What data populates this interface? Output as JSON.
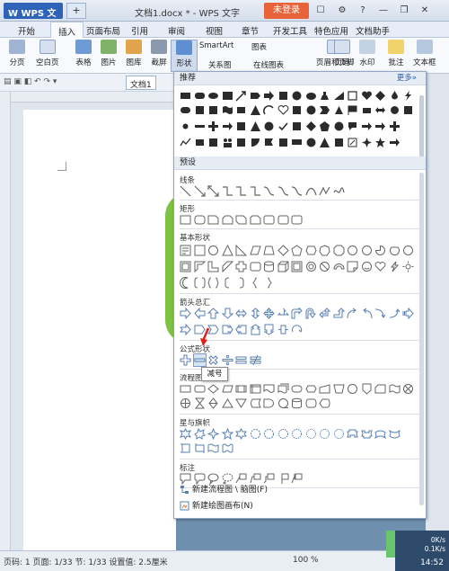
{
  "app": {
    "name": "W WPS 文字",
    "new_tab_symbol": "+",
    "window_title": "文档1.docx * - WPS 文字",
    "login_label": "未登录",
    "window_controls": [
      "minimize-icon",
      "restore-icon",
      "close-icon"
    ]
  },
  "tabs": [
    "开始",
    "插入",
    "页面布局",
    "引用",
    "审阅",
    "视图",
    "章节",
    "开发工具",
    "特色应用",
    "文档助手"
  ],
  "active_tab": "插入",
  "ribbon": {
    "items": [
      "分页",
      "空白页",
      "表格",
      "图片",
      "图库",
      "截屏",
      "形状",
      "SmartArt",
      "图表",
      "关系图",
      "在线图表",
      "页眉和页脚",
      "页码",
      "水印",
      "批注",
      "文本框"
    ]
  },
  "quick_access": {
    "doc_tab": "文档1"
  },
  "status": {
    "left": "页码: 1  页面: 1/33  节: 1/33  设置值: 2.5厘米",
    "zoom": "100 %"
  },
  "tray": {
    "net_up": "0K/s",
    "net_down": "0.1K/s",
    "clock": "14:52"
  },
  "panel": {
    "recommended_title": "推荐",
    "more_link": "更多»",
    "preset_title": "预设",
    "groups": {
      "lines": "线条",
      "rect": "矩形",
      "basic": "基本形状",
      "arrows": "箭头总汇",
      "formula": "公式形状",
      "flowchart": "流程图",
      "stars": "星与旗帜",
      "callouts": "标注"
    },
    "tooltip": "减号",
    "actions": [
      "新建流程图 \\ 脑图(F)",
      "新建绘图画布(N)"
    ]
  },
  "colors": {
    "accent": "#2f63b8",
    "login": "#e8623a",
    "green_shape": "#7ec243"
  }
}
